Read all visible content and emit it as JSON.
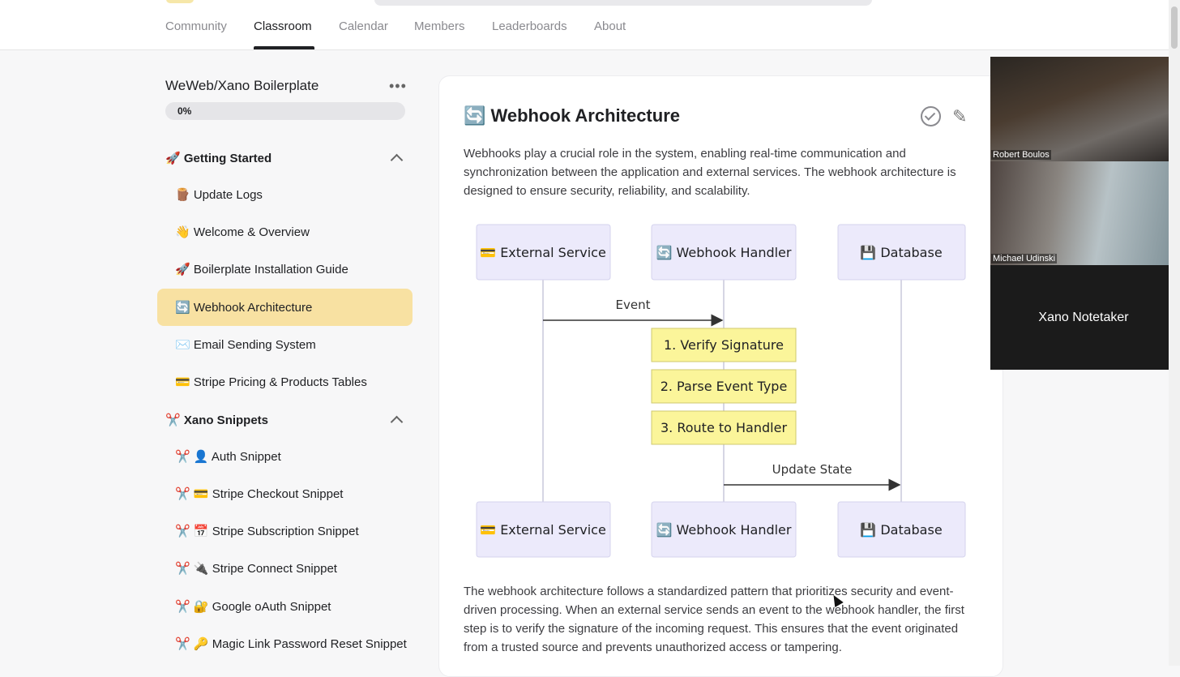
{
  "nav": {
    "tabs": [
      "Community",
      "Classroom",
      "Calendar",
      "Members",
      "Leaderboards",
      "About"
    ],
    "active": "Classroom"
  },
  "sidebar": {
    "course_title": "WeWeb/Xano Boilerplate",
    "more_icon": "more-horizontal-icon",
    "progress_label": "0%",
    "progress_value": 0,
    "sections": [
      {
        "title": "🚀 Getting Started",
        "items": [
          "🪵 Update Logs",
          "👋 Welcome & Overview",
          "🚀 Boilerplate Installation Guide",
          "🔄 Webhook Architecture",
          "✉️ Email Sending System",
          "💳 Stripe Pricing & Products Tables"
        ]
      },
      {
        "title": "✂️ Xano Snippets",
        "items": [
          "✂️ 👤 Auth Snippet",
          "✂️ 💳 Stripe Checkout Snippet",
          "✂️ 📅 Stripe Subscription Snippet",
          "✂️ 🔌 Stripe Connect Snippet",
          "✂️ 🔐 Google oAuth Snippet",
          "✂️ 🔑 Magic Link Password Reset Snippet"
        ]
      }
    ]
  },
  "lesson": {
    "title": "🔄 Webhook Architecture",
    "intro": "Webhooks play a crucial role in the system, enabling real-time communication and synchronization between the application and external services. The webhook architecture is designed to ensure security, reliability, and scalability.",
    "body": "The webhook architecture follows a standardized pattern that prioritizes security and event-driven processing. When an external service sends an event to the webhook handler, the first step is to verify the signature of the incoming request. This ensures that the event originated from a trusted source and prevents unauthorized access or tampering.",
    "complete_icon": "check-circle-icon",
    "edit_icon": "pencil-icon"
  },
  "diagram": {
    "participants": [
      "💳 External Service",
      "🔄 Webhook Handler",
      "💾 Database"
    ],
    "messages": [
      "Event",
      "Update State"
    ],
    "notes": [
      "1. Verify Signature",
      "2. Parse Event Type",
      "3. Route to Handler"
    ]
  },
  "video": {
    "participants": [
      "Robert Boulos",
      "Michael Udinski"
    ],
    "notetaker": "Xano Notetaker"
  }
}
